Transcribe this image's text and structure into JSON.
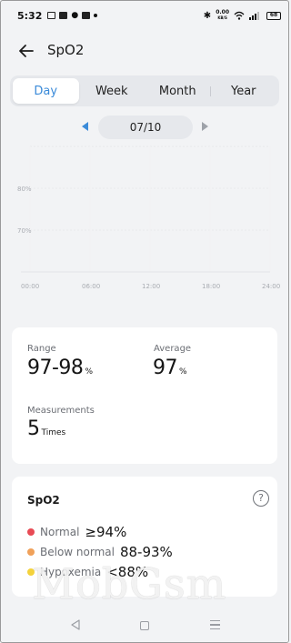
{
  "status_bar": {
    "time": "5:32",
    "net_speed_value": "0.00",
    "net_speed_unit": "KB/S",
    "battery": "68"
  },
  "header": {
    "title": "SpO2"
  },
  "tabs": [
    {
      "label": "Day",
      "active": true
    },
    {
      "label": "Week",
      "active": false
    },
    {
      "label": "Month",
      "active": false
    },
    {
      "label": "Year",
      "active": false
    }
  ],
  "date_nav": {
    "date": "07/10"
  },
  "chart_data": {
    "type": "line",
    "x_ticks": [
      "00:00",
      "06:00",
      "12:00",
      "18:00",
      "24:00"
    ],
    "y_ticks": [
      "80%",
      "70%"
    ],
    "ylim": [
      60,
      90
    ],
    "series": [],
    "grid": true,
    "colors": {
      "grid": "#e8e9ec",
      "axis_text": "#a8abb1"
    }
  },
  "stats": {
    "range_label": "Range",
    "range_value": "97-98",
    "range_unit": "%",
    "average_label": "Average",
    "average_value": "97",
    "average_unit": "%",
    "measurements_label": "Measurements",
    "measurements_value": "5",
    "measurements_unit": "Times"
  },
  "legend": {
    "title": "SpO2",
    "help_icon": "question-circle-icon",
    "items": [
      {
        "name": "Normal",
        "range": "≥94%",
        "color": "#e84b55"
      },
      {
        "name": "Below normal",
        "range": "88-93%",
        "color": "#f0a15a"
      },
      {
        "name": "Hypoxemia",
        "range": "<88%",
        "color": "#f4d23c"
      }
    ]
  },
  "watermark": "MobGsm"
}
